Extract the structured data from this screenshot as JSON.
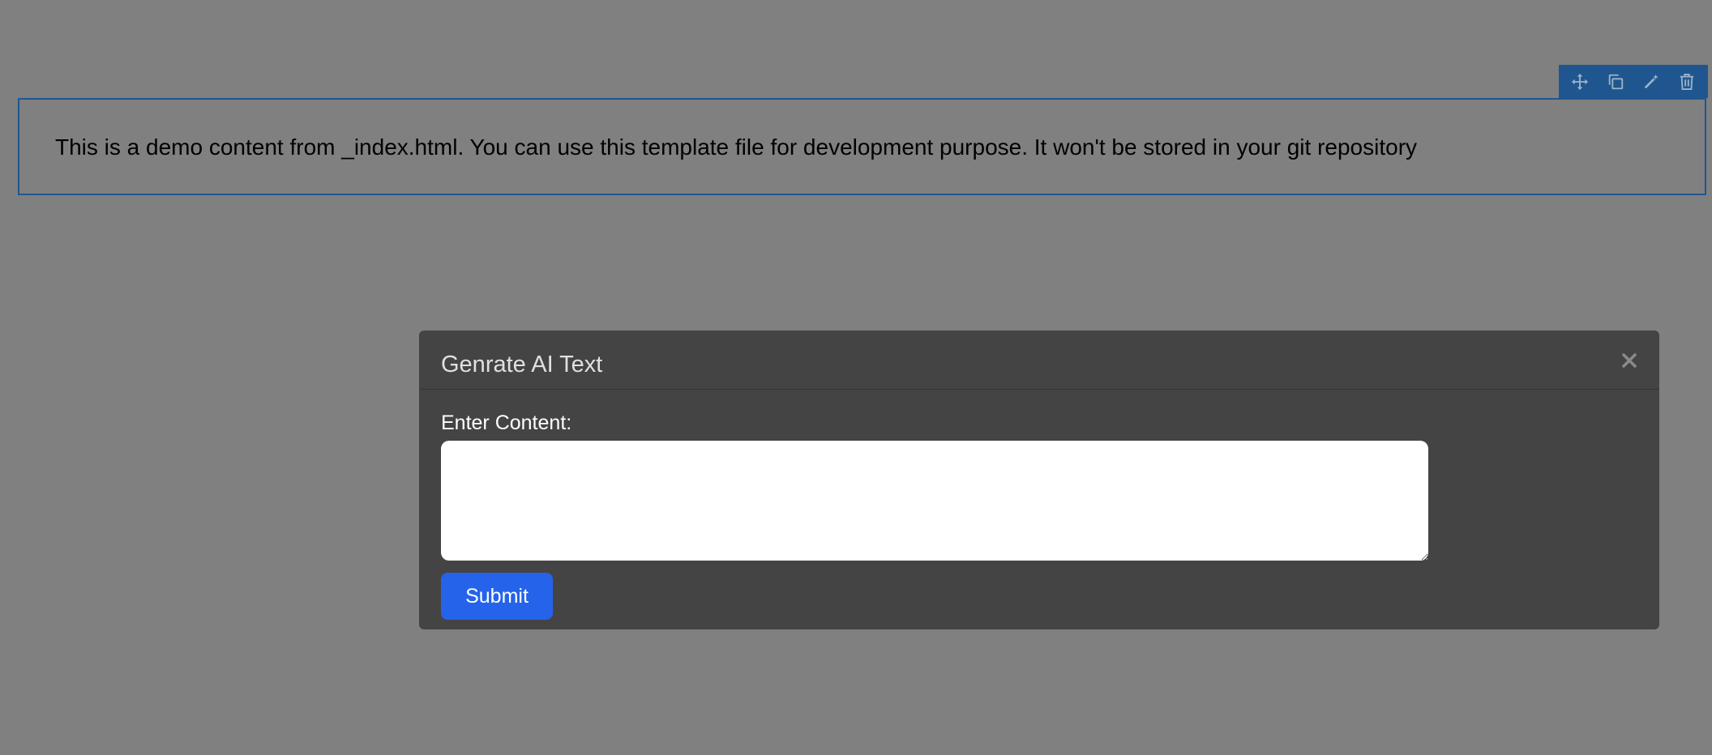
{
  "canvas": {
    "block_text": "This is a demo content from _index.html. You can use this template file for development purpose. It won't be stored in your git repository",
    "toolbar": {
      "icons": [
        "move-icon",
        "copy-icon",
        "magic-wand-icon",
        "trash-icon"
      ]
    }
  },
  "modal": {
    "title": "Genrate AI Text",
    "close_icon": "close-icon",
    "field_label": "Enter Content:",
    "textarea_value": "",
    "submit_label": "Submit"
  },
  "colors": {
    "overlay": "#808080",
    "selection_blue": "#1f5690",
    "modal_bg": "#444444",
    "submit_blue": "#2563eb"
  }
}
